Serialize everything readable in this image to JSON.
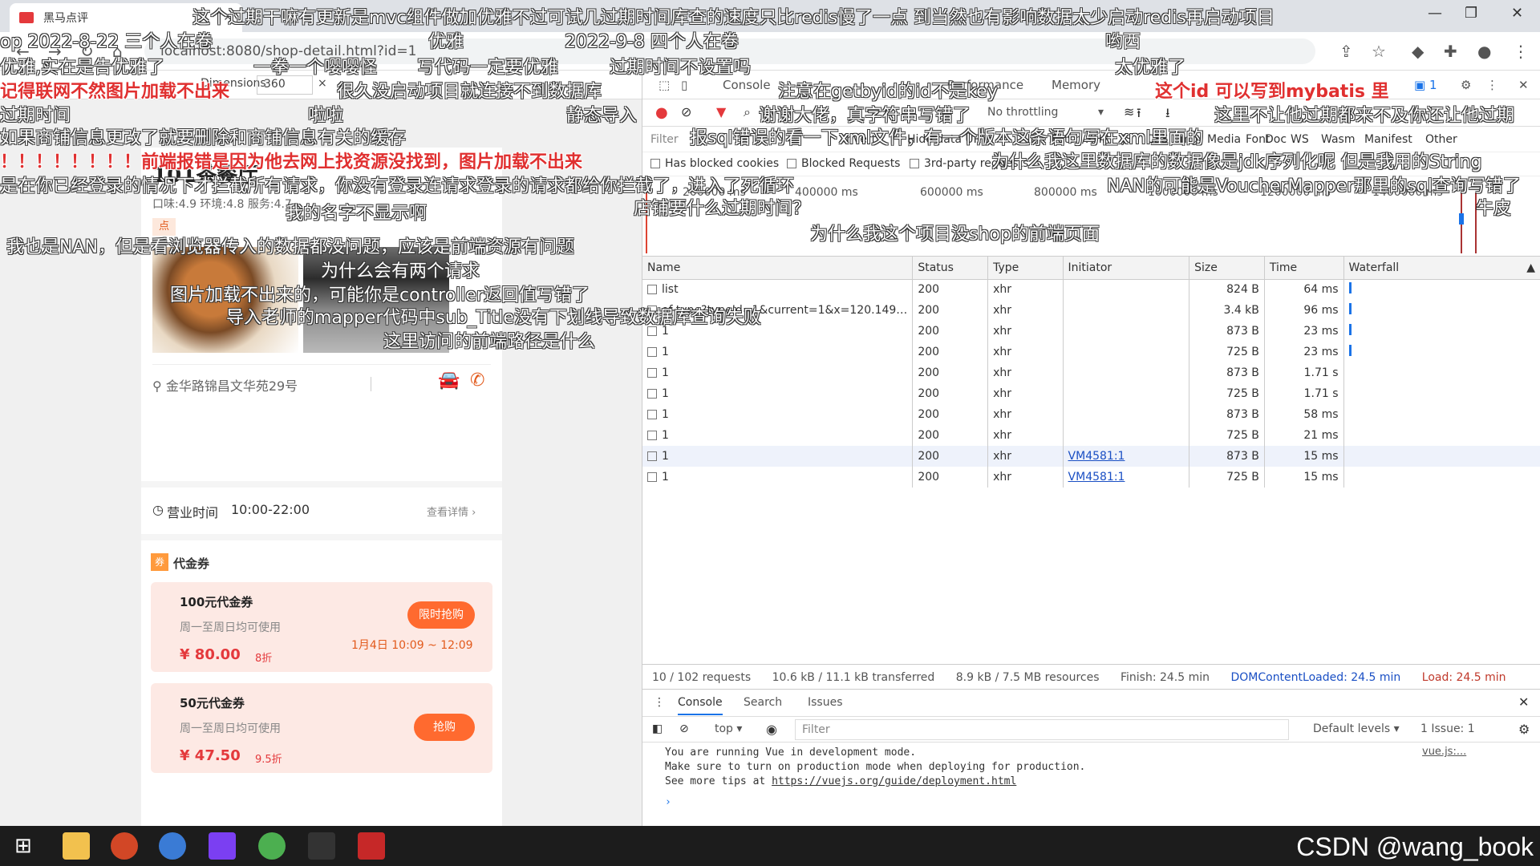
{
  "browser": {
    "tab_title": "黑马点评",
    "url": "localhost:8080/shop-detail.html?id=1"
  },
  "devtools_toolbar": {
    "width_value": "360"
  },
  "shop": {
    "name": "101茶餐厅",
    "scores": "口味:4.9 环境:4.8 服务:4.7",
    "tag": "点",
    "address": "金华路锦昌文华苑29号",
    "hours_label": "营业时间",
    "hours_value": "10:00-22:00",
    "hours_link": "查看详情 ›",
    "voucher_section": "代金券",
    "voucher_icon": "券",
    "vouchers": [
      {
        "title": "100元代金券",
        "subtitle": "周一至周日均可使用",
        "price": "¥ 80.00",
        "discount": "8折",
        "button": "限时抢购",
        "time": "1月4日 10:09 ~ 12:09"
      },
      {
        "title": "50元代金券",
        "subtitle": "周一至周日均可使用",
        "price": "¥ 47.50",
        "discount": "9.5折",
        "button": "抢购",
        "time": ""
      }
    ]
  },
  "devtools": {
    "tabs": [
      "Console",
      "Performance",
      "Memory"
    ],
    "issues_badge": "1",
    "throttle": "No throttling",
    "filter_placeholder": "Filter",
    "filter_types": [
      "Invert",
      "Hide data URLs",
      "All",
      "Fetch/XHR",
      "JS",
      "CSS",
      "Img",
      "Media",
      "Font",
      "Doc",
      "WS",
      "Wasm",
      "Manifest",
      "Other"
    ],
    "checks": [
      "Has blocked cookies",
      "Blocked Requests",
      "3rd-party requests"
    ],
    "timeline_ticks": [
      "200000 ms",
      "400000 ms",
      "600000 ms",
      "800000 ms",
      "1000000 ms",
      "1200000 ms",
      "1400000 ms"
    ],
    "columns": [
      "Name",
      "Status",
      "Type",
      "Initiator",
      "Size",
      "Time",
      "Waterfall"
    ],
    "rows": [
      {
        "name": "list",
        "status": "200",
        "type": "xhr",
        "initiator": "",
        "size": "824 B",
        "time": "64 ms"
      },
      {
        "name": "of-type?typeId=1&current=1&x=120.149…",
        "status": "200",
        "type": "xhr",
        "initiator": "",
        "size": "3.4 kB",
        "time": "96 ms"
      },
      {
        "name": "1",
        "status": "200",
        "type": "xhr",
        "initiator": "",
        "size": "873 B",
        "time": "23 ms"
      },
      {
        "name": "1",
        "status": "200",
        "type": "xhr",
        "initiator": "",
        "size": "725 B",
        "time": "23 ms"
      },
      {
        "name": "1",
        "status": "200",
        "type": "xhr",
        "initiator": "",
        "size": "873 B",
        "time": "1.71 s"
      },
      {
        "name": "1",
        "status": "200",
        "type": "xhr",
        "initiator": "",
        "size": "725 B",
        "time": "1.71 s"
      },
      {
        "name": "1",
        "status": "200",
        "type": "xhr",
        "initiator": "",
        "size": "873 B",
        "time": "58 ms"
      },
      {
        "name": "1",
        "status": "200",
        "type": "xhr",
        "initiator": "",
        "size": "725 B",
        "time": "21 ms"
      },
      {
        "name": "1",
        "status": "200",
        "type": "xhr",
        "initiator": "VM4581:1",
        "size": "873 B",
        "time": "15 ms"
      },
      {
        "name": "1",
        "status": "200",
        "type": "xhr",
        "initiator": "VM4581:1",
        "size": "725 B",
        "time": "15 ms"
      }
    ],
    "summary": {
      "requests": "10 / 102 requests",
      "transferred": "10.6 kB / 11.1 kB transferred",
      "resources": "8.9 kB / 7.5 MB resources",
      "finish": "Finish: 24.5 min",
      "dcl": "DOMContentLoaded: 24.5 min",
      "load": "Load: 24.5 min"
    },
    "drawer_tabs": [
      "Console",
      "Search",
      "Issues"
    ],
    "console_context": "top ▾",
    "console_filter": "Filter",
    "default_levels": "Default levels ▾",
    "issue_count": "1 Issue: 1",
    "console_lines": [
      "You are running Vue in development mode.",
      "Make sure to turn on production mode when deploying for production.",
      "See more tips at "
    ],
    "console_link": "https://vuejs.org/guide/deployment.html",
    "console_source": "vue.js:..."
  },
  "watermark": "CSDN @wang_book",
  "danmaku": [
    "这个过期干嘛有更新是mvc组件做加优雅不过可试几过期时间库查的速度只比redis慢了一点 到当然也有影响数据太少启动redis再启动项目",
    "op 2022-8-22 三个人在卷",
    "优雅",
    "2022-9-8 四个人在卷",
    "哟西",
    "优雅,实在是告优雅了",
    "一拳一个嘤嘤怪",
    "写代码一定要优雅",
    "过期时间不设置吗",
    "太优雅了",
    "记得联网不然图片加载不出来",
    "很久没启动项目就连接不到数据库",
    "注意在getbyid的id不是key",
    "这个id 可以写到mybatis 里",
    "过期时间",
    "啦啦",
    "静态导入",
    "谢谢大佬，真字符串写错了",
    "这里不让他过期都来不及你还让他过期",
    "如果商铺信息更改了就要删除和商铺信息有关的缓存",
    "报sql错误的看一下xml文件，有一个版本这条语句写在xml里面的",
    "！！！！！！！！前端报错是因为他去网上找资源没找到，图片加载不出来",
    "为什么我这里数据库的数据像是jdk序列化呢 但是我用的String",
    "是在你已经登录的情况下才拦截所有请求，你没有登录连请求登录的请求都给你拦截了，进入了死循环",
    "NAN的可能是VoucherMapper那里的sql查询写错了",
    "我的名字不显示啊",
    "店铺要什么过期时间？",
    "牛皮",
    "我也是NAN，但是看浏览器传入的数据都没问题，应该是前端资源有问题",
    "为什么我这个项目没shop的前端页面",
    "为什么会有两个请求",
    "图片加载不出来的，可能你是controller返回值写错了",
    "导入老师的mapper代码中sub_Title没有下划线导致数据库查询失败",
    "这里访问的前端路径是什么"
  ]
}
